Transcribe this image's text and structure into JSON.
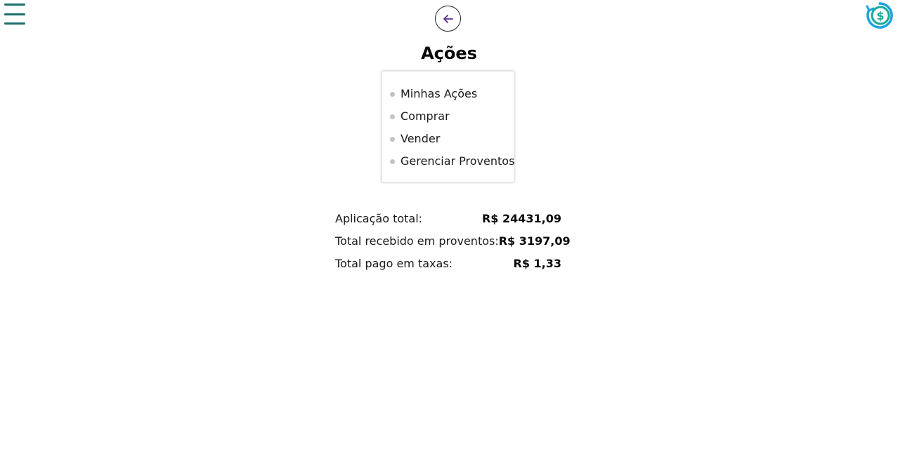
{
  "header": {
    "menu_icon": "hamburger-menu-icon",
    "back_icon": "arrow-left-icon",
    "logo_icon": "dollar-cycle-logo-icon"
  },
  "page": {
    "title": "Ações"
  },
  "menu": {
    "items": [
      {
        "label": "Minhas Ações"
      },
      {
        "label": "Comprar"
      },
      {
        "label": "Vender"
      },
      {
        "label": "Gerenciar Proventos"
      }
    ]
  },
  "summary": {
    "rows": [
      {
        "label": "Aplicação total:",
        "value": "R$ 24431,09"
      },
      {
        "label": "Total recebido em proventos:",
        "value": "R$ 3197,09"
      },
      {
        "label": "Total pago em taxas:",
        "value": "R$ 1,33"
      }
    ]
  },
  "colors": {
    "menu_icon": "#1b6e6e",
    "back_arrow": "#5b2d8c",
    "logo_teal": "#17a89a",
    "logo_blue": "#1aa3e0",
    "bullet": "#c4c4c4"
  }
}
